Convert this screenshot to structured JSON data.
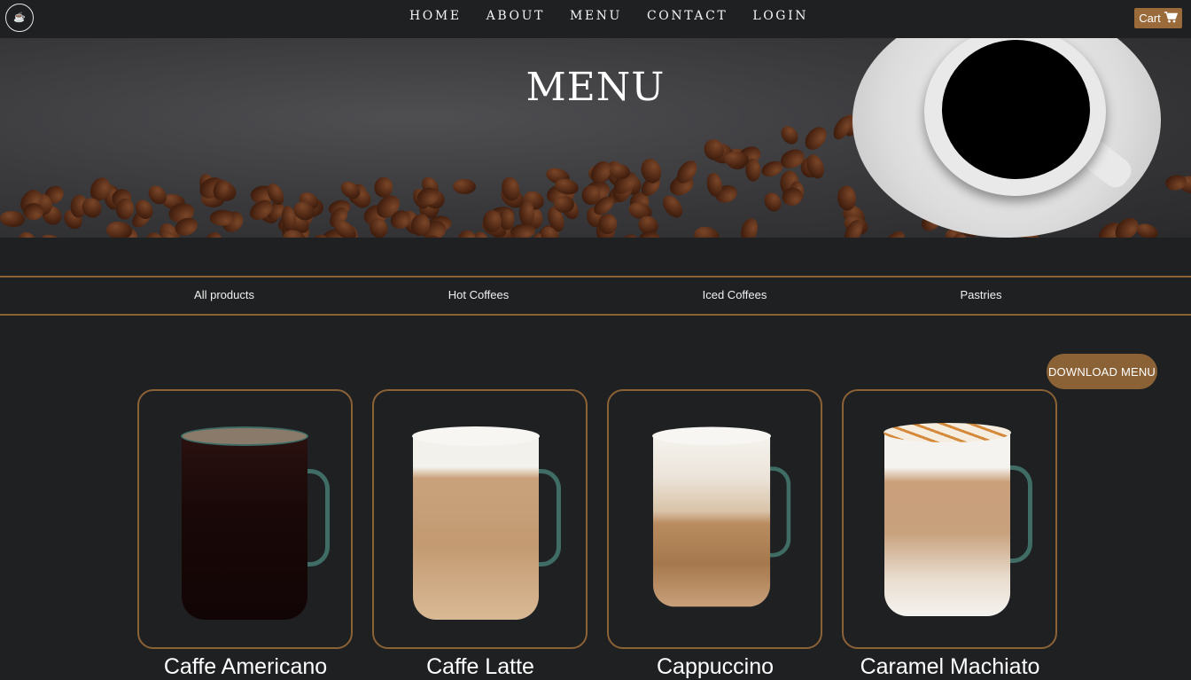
{
  "nav": {
    "links": [
      "HOME",
      "ABOUT",
      "MENU",
      "CONTACT",
      "LOGIN"
    ],
    "cart_label": "Cart",
    "cart_icon": "shopping-cart-icon",
    "logo_icon": "coffee-cup-logo"
  },
  "hero": {
    "title": "MENU"
  },
  "filters": [
    "All products",
    "Hot Coffees",
    "Iced Coffees",
    "Pastries"
  ],
  "download_button": "DOWNLOAD MENU",
  "products": [
    {
      "name": "Caffe Americano"
    },
    {
      "name": "Caffe Latte"
    },
    {
      "name": "Cappuccino"
    },
    {
      "name": "Caramel Machiato"
    }
  ],
  "colors": {
    "background": "#1f2022",
    "accent": "#8b6136",
    "cart_button": "#9a6a3a"
  }
}
